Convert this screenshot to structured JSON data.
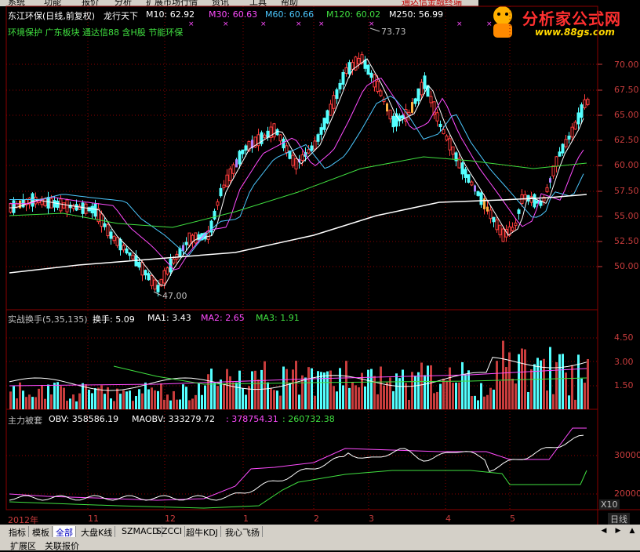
{
  "menu": {
    "items": [
      "系统",
      "功能",
      "报价",
      "分析",
      "扩展市场行情",
      "资讯",
      "工具",
      "帮助"
    ],
    "right_label": "通达信金融终端"
  },
  "logo": {
    "title": "分析家公式网",
    "url_text": "www.88gs.com"
  },
  "main_panel": {
    "header": {
      "stock": "东江环保(日线,前复权)",
      "formula": "龙行天下",
      "ma": [
        {
          "label": "M10: 62.92",
          "color": "#ffffff"
        },
        {
          "label": "M30: 60.63",
          "color": "#ff4cff"
        },
        {
          "label": "M60: 60.66",
          "color": "#4cc8ff"
        },
        {
          "label": "M120: 60.02",
          "color": "#40e040"
        },
        {
          "label": "M250: 56.99",
          "color": "#ffffff"
        }
      ]
    },
    "concepts": "环境保护 广东板块 通达信88 含H股 节能环保",
    "high_label": "73.73",
    "low_label": "47.00",
    "y_ticks": [
      "70.00",
      "67.50",
      "65.00",
      "62.50",
      "60.00",
      "57.50",
      "55.00",
      "52.50",
      "50.00"
    ]
  },
  "turnover_panel": {
    "header": [
      {
        "label": "实战换手(5,35,135)",
        "color": "#c0c0c0"
      },
      {
        "label": "换手: 5.09",
        "color": "#ffffff"
      },
      {
        "label": "MA1: 3.43",
        "color": "#ffffff"
      },
      {
        "label": "MA2: 2.65",
        "color": "#ff4cff"
      },
      {
        "label": "MA3: 1.91",
        "color": "#40e040"
      }
    ],
    "y_ticks": [
      "4.50",
      "3.00",
      "1.50"
    ]
  },
  "obv_panel": {
    "header": [
      {
        "label": "主力被套",
        "color": "#c0c0c0"
      },
      {
        "label": "OBV: 358586.19",
        "color": "#ffffff"
      },
      {
        "label": "MAOBV: 333279.72",
        "color": "#ffffff"
      },
      {
        "label": ": 378754.31",
        "color": "#ff4cff"
      },
      {
        "label": ": 260732.38",
        "color": "#40e040"
      }
    ],
    "y_ticks": [
      "30000",
      "20000"
    ],
    "scale_label": "X10"
  },
  "time_axis": {
    "labels": [
      "2012年",
      "11",
      "12",
      "1",
      "2",
      "3",
      "4",
      "5"
    ],
    "period": "日线"
  },
  "tabs": [
    "指标",
    "模板",
    "全部",
    "大盘K线",
    "SZMACD",
    "SZCCI",
    "超牛KDJ",
    "我心飞扬"
  ],
  "active_tab": "全部",
  "bottom_tabs": [
    "扩展区",
    "关联报价"
  ],
  "colors": {
    "up": "#ff3c3c",
    "down": "#54ffff",
    "grid": "#8b0000",
    "axis": "#c83c3c"
  }
}
